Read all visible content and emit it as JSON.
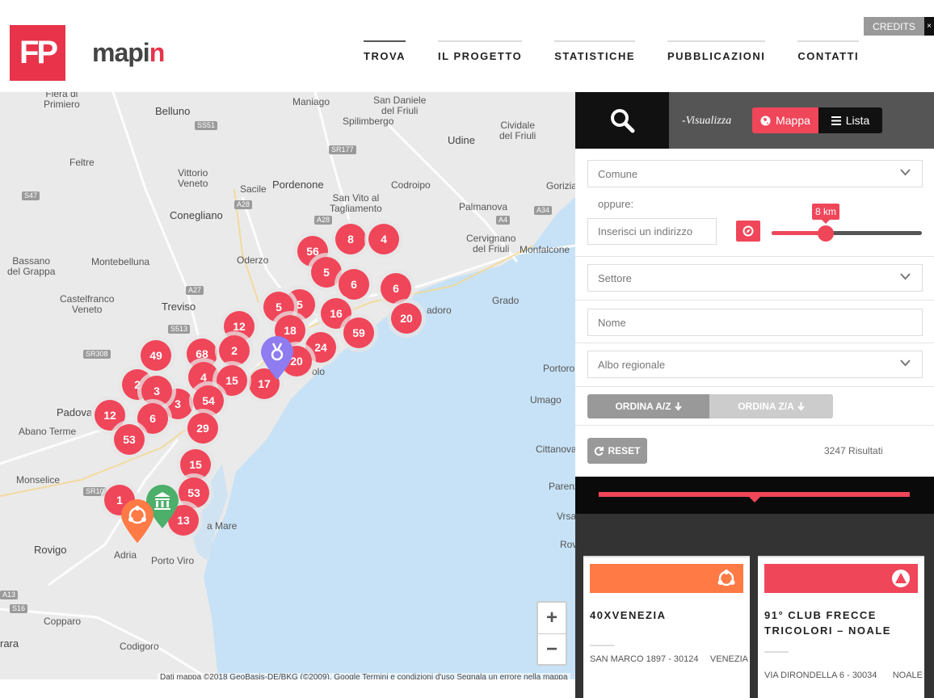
{
  "header": {
    "logo_mark": "FP",
    "logo_text_main": "mapi",
    "logo_text_accent": "n",
    "nav": [
      {
        "label": "TROVA",
        "active": true
      },
      {
        "label": "IL PROGETTO",
        "active": false
      },
      {
        "label": "STATISTICHE",
        "active": false
      },
      {
        "label": "PUBBLICAZIONI",
        "active": false
      },
      {
        "label": "CONTATTI",
        "active": false
      }
    ],
    "credits_label": "CREDITS",
    "credits_close": "×"
  },
  "map": {
    "places": [
      {
        "name": "Fiera di\nPrimiero"
      },
      {
        "name": "Belluno"
      },
      {
        "name": "Maniago"
      },
      {
        "name": "San Daniele\ndel Friuli"
      },
      {
        "name": "Spilimbergo"
      },
      {
        "name": "Cividale\ndel Friuli"
      },
      {
        "name": "Udine"
      },
      {
        "name": "Feltre"
      },
      {
        "name": "Vittorio\nVeneto"
      },
      {
        "name": "Sacile"
      },
      {
        "name": "Pordenone"
      },
      {
        "name": "Codroipo"
      },
      {
        "name": "Gorizia"
      },
      {
        "name": "San Vito al\nTagliamento"
      },
      {
        "name": "Palmanova"
      },
      {
        "name": "Conegliano"
      },
      {
        "name": "Cervignano\ndel Friuli"
      },
      {
        "name": "Monfalcone"
      },
      {
        "name": "Bassano\ndel Grappa"
      },
      {
        "name": "Montebelluna"
      },
      {
        "name": "Oderzo"
      },
      {
        "name": "Castelfranco\nVeneto"
      },
      {
        "name": "Treviso"
      },
      {
        "name": "Grado"
      },
      {
        "name": "Padova"
      },
      {
        "name": "Abano Terme"
      },
      {
        "name": "Monselice"
      },
      {
        "name": "Portoro"
      },
      {
        "name": "Umago"
      },
      {
        "name": "Cittanova"
      },
      {
        "name": "Parenz"
      },
      {
        "name": "Vrsa"
      },
      {
        "name": "Rov"
      },
      {
        "name": "Rovigo"
      },
      {
        "name": "Adria"
      },
      {
        "name": "Porto Viro"
      },
      {
        "name": "Copparo"
      },
      {
        "name": "Codigoro"
      },
      {
        "name": "rara"
      },
      {
        "name": "adoro"
      },
      {
        "name": "olo"
      },
      {
        "name": "a Mare"
      }
    ],
    "roads": [
      "SS51",
      "SR177",
      "S47",
      "A28",
      "A28",
      "A4",
      "A34",
      "A27",
      "SR308",
      "S513",
      "SR10",
      "A13",
      "S16"
    ],
    "clusters": [
      "56",
      "8",
      "4",
      "5",
      "6",
      "6",
      "20",
      "5",
      "5",
      "16",
      "59",
      "12",
      "18",
      "24",
      "20",
      "17",
      "49",
      "68",
      "2",
      "4",
      "15",
      "2",
      "3",
      "54",
      "3",
      "12",
      "6",
      "29",
      "53",
      "15",
      "53",
      "1",
      "13"
    ],
    "zoom_in": "+",
    "zoom_out": "−",
    "attribution": "Dati mappa ©2018 GeoBasis-DE/BKG (©2009), Google    Termini e condizioni d'uso    Segnala un errore nella mappa"
  },
  "panel": {
    "visualizza": "-Visualizza",
    "toggle_map": "Mappa",
    "toggle_list": "Lista",
    "comune_placeholder": "Comune",
    "oppure": "oppure:",
    "address_placeholder": "Inserisci un indirizzo",
    "radius_label": "8 km",
    "radius_value": 0.36,
    "settore_placeholder": "Settore",
    "nome_placeholder": "Nome",
    "albo_placeholder": "Albo regionale",
    "sort_az": "ORDINA A/Z",
    "sort_za": "ORDINA Z/A",
    "reset": "RESET",
    "results": "3247 Risultati",
    "colors": {
      "accent": "#f0465a",
      "orange": "#ff7a45"
    },
    "cards": [
      {
        "title": "40XVENEZIA",
        "address": "SAN MARCO 1897 - 30124",
        "city": "VENEZIA",
        "color": "#ff7a45",
        "icon": "community-icon"
      },
      {
        "title": "91° CLUB FRECCE TRICOLORI – NOALE",
        "address": "VIA DIRONDELLA 6 - 30034",
        "city": "NOALE",
        "color": "#f0465a",
        "icon": "triangle-icon"
      }
    ]
  }
}
